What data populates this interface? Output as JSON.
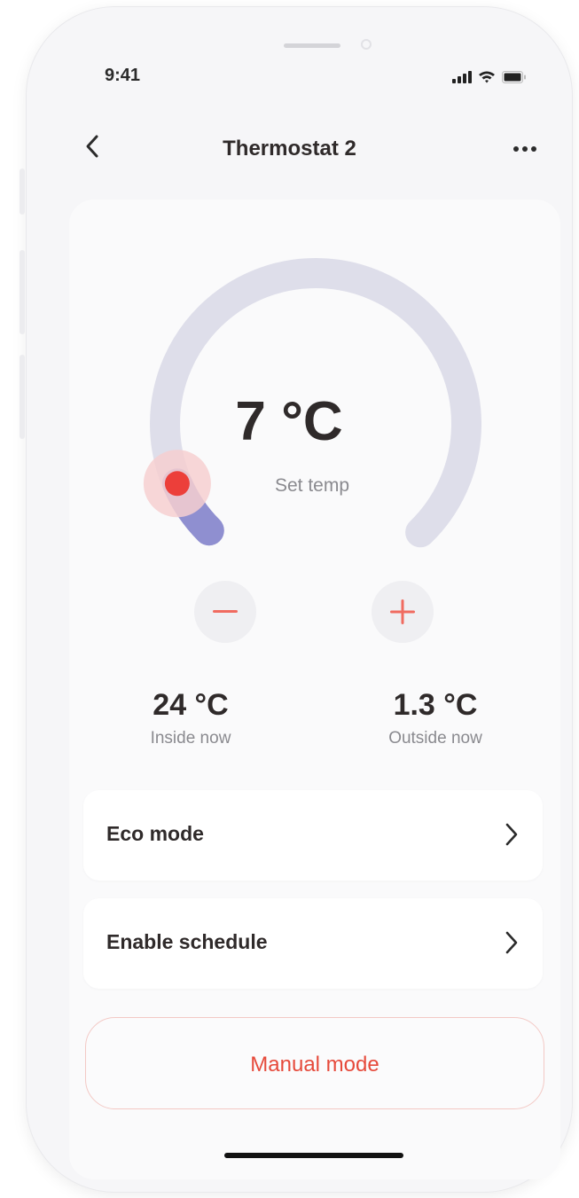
{
  "status_bar": {
    "time": "9:41",
    "icons": [
      "signal-icon",
      "wifi-icon",
      "battery-icon"
    ]
  },
  "nav": {
    "back_icon": "chevron-left-icon",
    "title": "Thermostat 2",
    "more_icon": "more-horizontal-icon"
  },
  "dial": {
    "set_temp": "7 °C",
    "set_temp_label": "Set temp",
    "level_fraction": 0.08,
    "track_color": "#dedeea",
    "fill_color": "#8f8fd0",
    "knob_color": "#ec3f3a"
  },
  "controls": {
    "decrease_icon": "minus-icon",
    "increase_icon": "plus-icon",
    "accent_color": "#f06b60"
  },
  "readings": {
    "inside_value": "24 °C",
    "inside_label": "Inside now",
    "outside_value": "1.3 °C",
    "outside_label": "Outside now"
  },
  "options": [
    {
      "label": "Eco mode",
      "icon": "chevron-right-icon"
    },
    {
      "label": "Enable schedule",
      "icon": "chevron-right-icon"
    }
  ],
  "manual_button": {
    "label": "Manual mode",
    "color": "#e64a3b"
  }
}
